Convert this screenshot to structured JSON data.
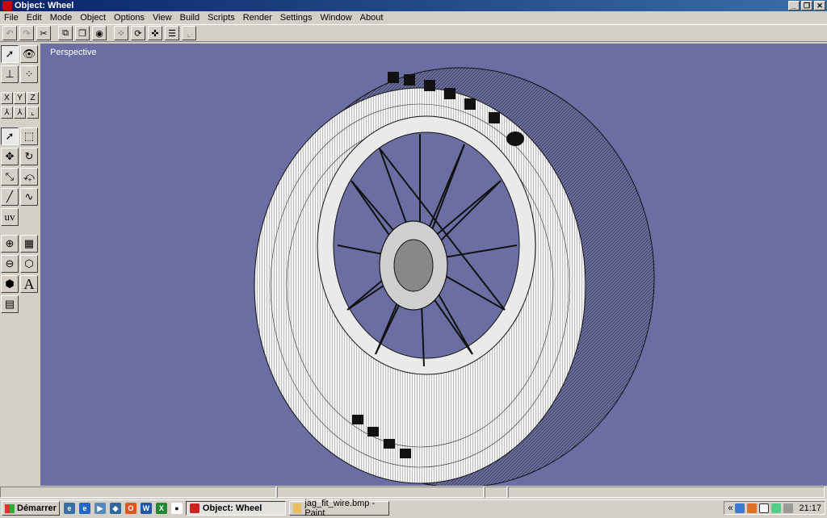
{
  "window": {
    "title": "Object: Wheel"
  },
  "menu": [
    "File",
    "Edit",
    "Mode",
    "Object",
    "Options",
    "View",
    "Build",
    "Scripts",
    "Render",
    "Settings",
    "Window",
    "About"
  ],
  "toolbar": {
    "icons": [
      "undo-icon",
      "redo-icon",
      "cut-icon",
      "copy-icon",
      "duplicate-icon",
      "sphere-icon",
      "grid-icon",
      "rotate-icon",
      "snap-icon",
      "list-icon",
      "graph-icon"
    ]
  },
  "palette": {
    "axis_x": "X",
    "axis_y": "Y",
    "axis_z": "Z",
    "uv_label": "uv",
    "text_label": "A"
  },
  "viewport": {
    "label": "Perspective",
    "background": "#6a6ea3"
  },
  "taskbar": {
    "start_label": "Démarrer",
    "tasks": [
      "Object: Wheel",
      "jag_fit_wire.bmp - Paint"
    ],
    "tray_arrow": "«",
    "clock": "21:17"
  }
}
